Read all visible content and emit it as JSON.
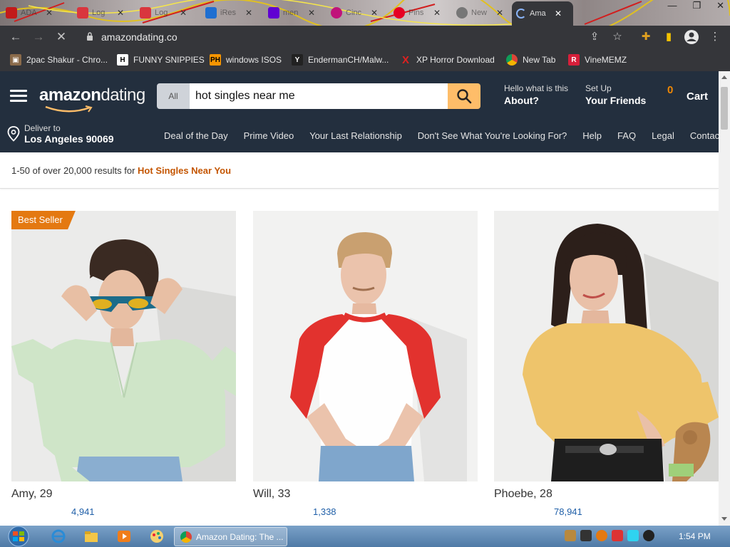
{
  "browser": {
    "tabs": [
      {
        "title": "ADA",
        "color": "#c21a1a"
      },
      {
        "title": "Log",
        "color": "#d9363e"
      },
      {
        "title": "Log",
        "color": "#d9363e"
      },
      {
        "title": "iRes",
        "color": "#1f6fd1"
      },
      {
        "title": "men",
        "color": "#6001d2"
      },
      {
        "title": "Cinc",
        "color": "#c0147a"
      },
      {
        "title": "Pins",
        "color": "#e60023"
      },
      {
        "title": "New",
        "color": "#777777"
      }
    ],
    "active_tab": {
      "title": "Ama"
    },
    "url": "amazondating.co",
    "bookmarks": [
      {
        "label": "2pac Shakur - Chro...",
        "icon": "2pac-icon"
      },
      {
        "label": "FUNNY SNIPPIES",
        "icon": "H"
      },
      {
        "label": "windows ISOS",
        "icon": "PH"
      },
      {
        "label": "EndermanCH/Malw...",
        "icon": "YP"
      },
      {
        "label": "XP Horror Download",
        "icon": "X"
      },
      {
        "label": "New Tab",
        "icon": "chrome-icon"
      },
      {
        "label": "VineMEMZ",
        "icon": "R"
      }
    ]
  },
  "site": {
    "logo_bold": "amazon",
    "logo_light": "dating",
    "search": {
      "category": "All",
      "query": "hot singles near me"
    },
    "about": {
      "small": "Hello what is this",
      "big": "About?"
    },
    "friends": {
      "small": "Set Up",
      "big": "Your Friends"
    },
    "cart": {
      "count": "0",
      "label": "Cart"
    },
    "deliver": {
      "line1": "Deliver to",
      "line2": "Los Angeles 90069"
    },
    "nav": [
      "Deal of the Day",
      "Prime Video",
      "Your Last Relationship",
      "Don't See What You're Looking For?",
      "Help",
      "FAQ",
      "Legal",
      "Contact"
    ],
    "results": {
      "prefix": "1-50 of over 20,000 results for ",
      "query": "Hot Singles Near You"
    },
    "cards": [
      {
        "name": "Amy, 29",
        "rating_count": "4,941",
        "badge": "Best Seller"
      },
      {
        "name": "Will, 33",
        "rating_count": "1,338",
        "badge": ""
      },
      {
        "name": "Phoebe, 28",
        "rating_count": "78,941",
        "badge": ""
      }
    ]
  },
  "taskbar": {
    "active_window": "Amazon Dating: The ...",
    "time": "1:54 PM"
  },
  "colors": {
    "header": "#232f3e",
    "search_button": "#febd69",
    "cart_count": "#f08804",
    "badge": "#e47911",
    "results_query": "#c45500"
  }
}
